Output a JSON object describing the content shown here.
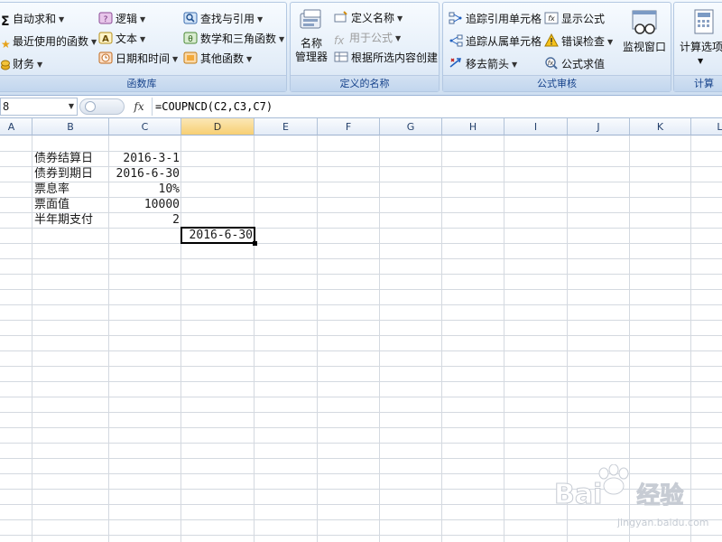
{
  "ribbon": {
    "function_library": {
      "title": "函数库",
      "autosum": "自动求和",
      "recent": "最近使用的函数",
      "finance": "财务",
      "logic": "逻辑",
      "text": "文本",
      "datetime": "日期和时间",
      "lookup": "查找与引用",
      "math": "数学和三角函数",
      "other": "其他函数"
    },
    "defined_names": {
      "title": "定义的名称",
      "name_manager_line1": "名称",
      "name_manager_line2": "管理器",
      "define_name": "定义名称",
      "use_in_formula": "用于公式",
      "create_from_selection": "根据所选内容创建"
    },
    "formula_auditing": {
      "title": "公式审核",
      "trace_precedents": "追踪引用单元格",
      "trace_dependents": "追踪从属单元格",
      "remove_arrows": "移去箭头",
      "show_formulas": "显示公式",
      "error_checking": "错误检查",
      "evaluate_formula": "公式求值",
      "watch_window": "监视窗口"
    },
    "calculation": {
      "title": "计算",
      "options": "计算选项"
    }
  },
  "formula_bar": {
    "name_box": "8",
    "fx": "fx",
    "formula": "=COUPNCD(C2,C3,C7)"
  },
  "columns": [
    "A",
    "B",
    "C",
    "D",
    "E",
    "F",
    "G",
    "H",
    "I",
    "J",
    "K",
    "L"
  ],
  "active_column": "D",
  "cells": {
    "b2": "债券结算日",
    "c2": "2016-3-1",
    "b3": "债券到期日",
    "c3": "2016-6-30",
    "b4": "票息率",
    "c4": "10%",
    "b5": "票面值",
    "c5": "10000",
    "b6": "半年期支付",
    "c6": "2",
    "d7": "2016-6-30"
  },
  "watermark": {
    "brand": "Bai",
    "brand_suffix": "经验",
    "url": "jingyan.baidu.com"
  },
  "colors": {
    "accent": "#15428b",
    "active_header": "#f7cf73"
  }
}
